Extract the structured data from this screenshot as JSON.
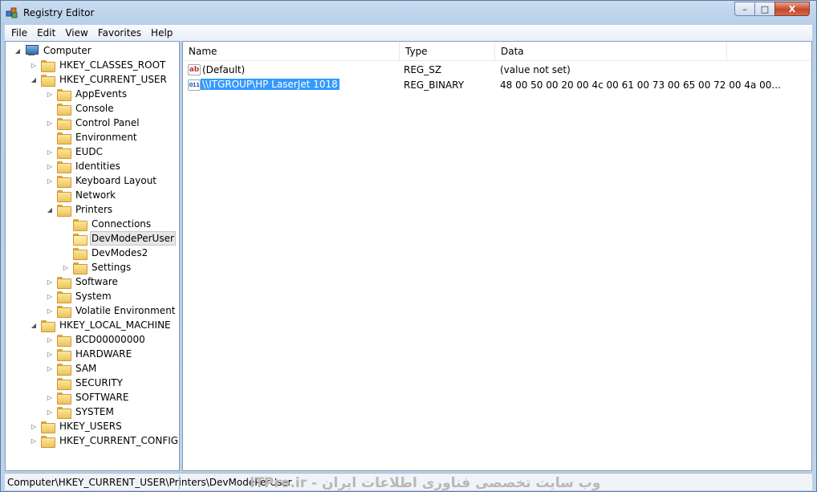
{
  "window": {
    "title": "Registry Editor",
    "min_label": "–",
    "max_label": "□",
    "close_label": "X"
  },
  "menubar": [
    "File",
    "Edit",
    "View",
    "Favorites",
    "Help"
  ],
  "tree": [
    {
      "label": "Computer",
      "expander": "◢",
      "icon": "computer-icon",
      "level": 0
    },
    {
      "label": "HKEY_CLASSES_ROOT",
      "expander": "▷",
      "icon": "folder-icon",
      "level": 1
    },
    {
      "label": "HKEY_CURRENT_USER",
      "expander": "◢",
      "icon": "folder-icon",
      "level": 1
    },
    {
      "label": "AppEvents",
      "expander": "▷",
      "icon": "folder-icon",
      "level": 2
    },
    {
      "label": "Console",
      "expander": "",
      "icon": "folder-icon",
      "level": 2
    },
    {
      "label": "Control Panel",
      "expander": "▷",
      "icon": "folder-icon",
      "level": 2
    },
    {
      "label": "Environment",
      "expander": "",
      "icon": "folder-icon",
      "level": 2
    },
    {
      "label": "EUDC",
      "expander": "▷",
      "icon": "folder-icon",
      "level": 2
    },
    {
      "label": "Identities",
      "expander": "▷",
      "icon": "folder-icon",
      "level": 2
    },
    {
      "label": "Keyboard Layout",
      "expander": "▷",
      "icon": "folder-icon",
      "level": 2
    },
    {
      "label": "Network",
      "expander": "",
      "icon": "folder-icon",
      "level": 2
    },
    {
      "label": "Printers",
      "expander": "◢",
      "icon": "folder-icon",
      "level": 2
    },
    {
      "label": "Connections",
      "expander": "",
      "icon": "folder-icon",
      "level": 3
    },
    {
      "label": "DevModePerUser",
      "expander": "",
      "icon": "folder-icon",
      "level": 3,
      "selected": true
    },
    {
      "label": "DevModes2",
      "expander": "",
      "icon": "folder-icon",
      "level": 3
    },
    {
      "label": "Settings",
      "expander": "▷",
      "icon": "folder-icon",
      "level": 3
    },
    {
      "label": "Software",
      "expander": "▷",
      "icon": "folder-icon",
      "level": 2
    },
    {
      "label": "System",
      "expander": "▷",
      "icon": "folder-icon",
      "level": 2
    },
    {
      "label": "Volatile Environment",
      "expander": "▷",
      "icon": "folder-icon",
      "level": 2
    },
    {
      "label": "HKEY_LOCAL_MACHINE",
      "expander": "◢",
      "icon": "folder-icon",
      "level": 1
    },
    {
      "label": "BCD00000000",
      "expander": "▷",
      "icon": "folder-icon",
      "level": 2
    },
    {
      "label": "HARDWARE",
      "expander": "▷",
      "icon": "folder-icon",
      "level": 2
    },
    {
      "label": "SAM",
      "expander": "▷",
      "icon": "folder-icon",
      "level": 2
    },
    {
      "label": "SECURITY",
      "expander": "",
      "icon": "folder-icon",
      "level": 2
    },
    {
      "label": "SOFTWARE",
      "expander": "▷",
      "icon": "folder-icon",
      "level": 2
    },
    {
      "label": "SYSTEM",
      "expander": "▷",
      "icon": "folder-icon",
      "level": 2
    },
    {
      "label": "HKEY_USERS",
      "expander": "▷",
      "icon": "folder-icon",
      "level": 1
    },
    {
      "label": "HKEY_CURRENT_CONFIG",
      "expander": "▷",
      "icon": "folder-icon",
      "level": 1
    }
  ],
  "list": {
    "columns": [
      "Name",
      "Type",
      "Data"
    ],
    "rows": [
      {
        "name": "(Default)",
        "type": "REG_SZ",
        "data": "(value not set)",
        "icon": "string-value-icon",
        "icon_text": "ab",
        "selected": false
      },
      {
        "name": "\\\\ITGROUP\\HP LaserJet 1018",
        "type": "REG_BINARY",
        "data": "48 00 50 00 20 00 4c 00 61 00 73 00 65 00 72 00 4a 00...",
        "icon": "binary-value-icon",
        "icon_text": "011",
        "selected": true
      }
    ]
  },
  "statusbar": {
    "path": "Computer\\HKEY_CURRENT_USER\\Printers\\DevModePerUser",
    "watermark": "وب سایت تخصصی فناوری اطلاعات ایران - ITPro.ir"
  },
  "colors": {
    "selection": "#3399ff",
    "folder": "#efc25a"
  }
}
